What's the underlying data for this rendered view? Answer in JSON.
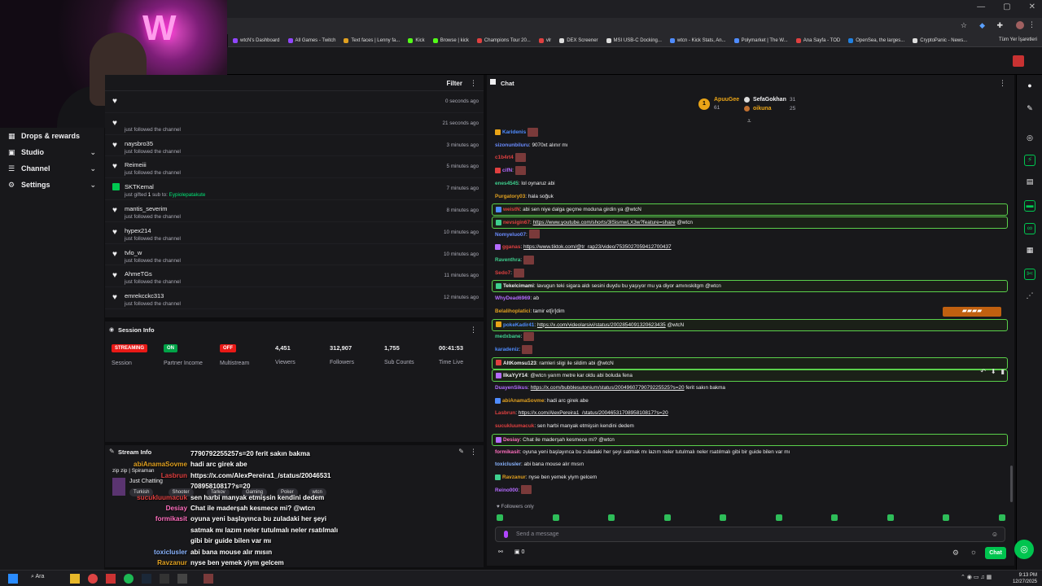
{
  "bookmarks": [
    "wtcN's Dashboard",
    "All Games - Twitch",
    "Text faces | Lenny fa...",
    "Kick",
    "Browse | kick",
    "Champions Tour 20...",
    "vlr",
    "DEX Screener",
    "MSI USB-C Docking...",
    "wtcn - Kick Stats, An...",
    "Polymarket | The W...",
    "Ana Sayfa - TOD",
    "OpenSea, the larges...",
    "CryptoPanic - News..."
  ],
  "bookmarks_right": "Tüm Yer İşaretleri",
  "nav": [
    {
      "label": "Drops & rewards",
      "icon": "gift-icon"
    },
    {
      "label": "Studio",
      "icon": "video-icon"
    },
    {
      "label": "Channel",
      "icon": "list-icon"
    },
    {
      "label": "Settings",
      "icon": "gear-icon"
    }
  ],
  "activity": {
    "filter_label": "Filter",
    "rows": [
      {
        "user": "",
        "sub": "",
        "time": "0 seconds ago",
        "type": "follow"
      },
      {
        "user": "",
        "sub": "just followed the channel",
        "time": "21 seconds ago",
        "type": "follow"
      },
      {
        "user": "naysbro35",
        "sub": "just followed the channel",
        "time": "3 minutes ago",
        "type": "follow"
      },
      {
        "user": "Reimeiii",
        "sub": "just followed the channel",
        "time": "5 minutes ago",
        "type": "follow"
      },
      {
        "user": "SKTKemal",
        "sub_prefix": "just gifted ",
        "sub_count": "1",
        "sub_mid": " sub to: ",
        "sub_target": "Eypiolepatakute",
        "time": "7 minutes ago",
        "type": "gift"
      },
      {
        "user": "mantis_severim",
        "sub": "just followed the channel",
        "time": "8 minutes ago",
        "type": "follow"
      },
      {
        "user": "hypex214",
        "sub": "just followed the channel",
        "time": "10 minutes ago",
        "type": "follow"
      },
      {
        "user": "tvlo_w",
        "sub": "just followed the channel",
        "time": "10 minutes ago",
        "type": "follow"
      },
      {
        "user": "AhmeTGs",
        "sub": "just followed the channel",
        "time": "11 minutes ago",
        "type": "follow"
      },
      {
        "user": "emrekcckc313",
        "sub": "just followed the channel",
        "time": "12 minutes ago",
        "type": "follow"
      }
    ]
  },
  "session": {
    "title": "Session Info",
    "stats": [
      {
        "badge": "STREAMING",
        "badge_color": "#e91916",
        "label": "Session"
      },
      {
        "badge": "ON",
        "badge_color": "#00a347",
        "label": "Partner Income"
      },
      {
        "badge": "OFF",
        "badge_color": "#e91916",
        "label": "Multistream"
      },
      {
        "value": "4,451",
        "label": "Viewers"
      },
      {
        "value": "312,907",
        "label": "Followers"
      },
      {
        "value": "1,755",
        "label": "Sub Counts"
      },
      {
        "value": "00:41:53",
        "label": "Time Live"
      }
    ]
  },
  "stream_info": {
    "title": "Stream Info",
    "stream_title": "zip zip | Spiraman",
    "category": "Just Chatting",
    "tags": [
      "Turkish",
      "Shooter",
      "Tarkov",
      "Gaming",
      "Poker",
      "wtcn"
    ]
  },
  "overlay": [
    {
      "name": "",
      "text": "7790792255257s=20 ferit sakın bakma"
    },
    {
      "name": "abiAnamaSovme",
      "name_color": "#e0a020",
      "text": "hadi arc girek abe"
    },
    {
      "name": "Lasbrun",
      "name_color": "#e04040",
      "text": "https://x.com/AlexPereira1_/status/20046531"
    },
    {
      "name": "",
      "text": "70895810817?s=20"
    },
    {
      "name": "sucukluumacuk",
      "name_color": "#e04040",
      "text": "sen harbi manyak etmişsin kendini dedem"
    },
    {
      "name": "Desiay",
      "name_color": "#ff6fbf",
      "text": "Chat ile maderşah kesmece mi? @wtcn"
    },
    {
      "name": "formikasit",
      "name_color": "#ff6fbf",
      "text": "oyuna yeni başlayınca bu zuladaki her şeyi"
    },
    {
      "name": "",
      "text": "satmak mı lazım neler tutulmalı neler rsatılmalı"
    },
    {
      "name": "",
      "text": "gibi bir guide bilen var mı"
    },
    {
      "name": "toxiclusler",
      "name_color": "#8ab4ff",
      "text": "abi bana mouse alır mısın"
    },
    {
      "name": "Ravzanur",
      "name_color": "#e0a020",
      "text": "nyse ben yemek yiym gelcem"
    },
    {
      "name": "Reino000",
      "name_color": "#b46bff",
      "text": ""
    }
  ],
  "chat": {
    "title": "Chat",
    "leaderboard": {
      "rank": "1",
      "first": {
        "name": "ApuuGee",
        "value": "61"
      },
      "second": {
        "name": "SefaGokhan",
        "value": "31"
      },
      "third": {
        "name": "oikuna",
        "value": "25"
      }
    },
    "messages": [
      {
        "name": "Karidenis",
        "color": "#4f8cff",
        "text": "",
        "emote": true
      },
      {
        "name": "sizonunbiluru",
        "color": "#6a8cff",
        "text": ": 9070xt alınır mı"
      },
      {
        "name": "c1b4rt4",
        "color": "#e04040",
        "text": "",
        "emote": true
      },
      {
        "name": "cifN",
        "color": "#b46bff",
        "text": ":",
        "emote": true
      },
      {
        "name": "enes4545",
        "color": "#3ecf8e",
        "text": ": lol oynaruz abi"
      },
      {
        "name": "Purgatory03",
        "color": "#e0a020",
        "text": ": hala soğuk"
      },
      {
        "name": "weistN",
        "color": "#e04040",
        "text": ": abi sen niye dalga geçme moduna girdin ya @wtcN",
        "hl": true
      },
      {
        "name": "nevsigin67",
        "color": "#e04040",
        "text": ": ",
        "link": "https://www.youtube.com/shorts/3lSismwLX3w?feature=share",
        "after": " @wtcn",
        "hl": true
      },
      {
        "name": "Nomyeluo07",
        "color": "#6a8cff",
        "text": ":",
        "emote": true
      },
      {
        "name": "gganas",
        "color": "#e04040",
        "text": ": ",
        "link": "https://www.tiktok.com/@tr_rap23/video/7535027059412700437"
      },
      {
        "name": "Raventhra",
        "color": "#3ecf8e",
        "text": ":",
        "emote": true
      },
      {
        "name": "Sedo7",
        "color": "#e04040",
        "text": ":",
        "emote": true
      },
      {
        "name": "Tekelcimami",
        "color": "#efeff1",
        "text": ": lavugun teki sigara aldı sesini duydu bu yaşıyor mu ya diyor amınıskitgm @wtcn",
        "hl": true
      },
      {
        "name": "WhyDead6969",
        "color": "#b46bff",
        "text": ": ab"
      },
      {
        "name": "Belalihoplatici",
        "color": "#e0a020",
        "text": ": tamir et[ir]dim"
      },
      {
        "name": "pokeKadir41",
        "color": "#4f8cff",
        "text": ": ",
        "link": "https://x.com/videolarsivi/status/2002854091320623435",
        "after": " @wtcN",
        "hl": true
      },
      {
        "name": "medxbane",
        "color": "#3ecf8e",
        "text": ":",
        "emote": true
      },
      {
        "name": "karadeniz",
        "color": "#4f8cff",
        "text": ":",
        "emote": true
      },
      {
        "name": "AltKomsu123",
        "color": "#efeff1",
        "text": ": ramleri sligi ile sildim abi @wtcN",
        "hl": true
      },
      {
        "name": "IlkaYyY14",
        "color": "#efeff1",
        "text": ": @wtcn yarım metre kar oldu abi boluda fena",
        "hl": true
      },
      {
        "name": "DuayenSikus",
        "color": "#b46bff",
        "text": ": ",
        "link": "https://x.com/bubblesutonium/status/2004960779079225525?s=20",
        "after": " ferit sakın bakma"
      },
      {
        "name": "abiAnamaSovme",
        "color": "#e0a020",
        "text": ": hadi arc girek abe"
      },
      {
        "name": "Lasbrun",
        "color": "#e04040",
        "text": ": ",
        "link": "https://x.com/AlexPereira1_/status/2004653170895810817?s=20"
      },
      {
        "name": "sucukluumacuk",
        "color": "#e04040",
        "text": ": sen harbi manyak etmişsin kendini dedem"
      },
      {
        "name": "Desiay",
        "color": "#ff6fbf",
        "text": ": Chat ile maderşah kesmece mi? @wtcn",
        "hl": true
      },
      {
        "name": "formikasit",
        "color": "#ff6fbf",
        "text": ": oyuna yeni başlayınca bu zuladaki her şeyi satmak mı lazım neler tutulmalı neler rsatılmalı gibi bir guide bilen var mı"
      },
      {
        "name": "toxiclusler",
        "color": "#8ab4ff",
        "text": ": abi bana mouse alır mısın"
      },
      {
        "name": "Ravzanur",
        "color": "#e0a020",
        "text": ": nyse ben yemek yiym gelcem"
      },
      {
        "name": "Reino000",
        "color": "#b46bff",
        "text": ":",
        "emote": true
      }
    ],
    "followers_only": "Followers only",
    "input_placeholder": "Send a message",
    "points": "0",
    "send_label": "Chat"
  },
  "taskbar": {
    "search": "Ara",
    "time": "9:13 PM",
    "date": "12/27/2025"
  }
}
